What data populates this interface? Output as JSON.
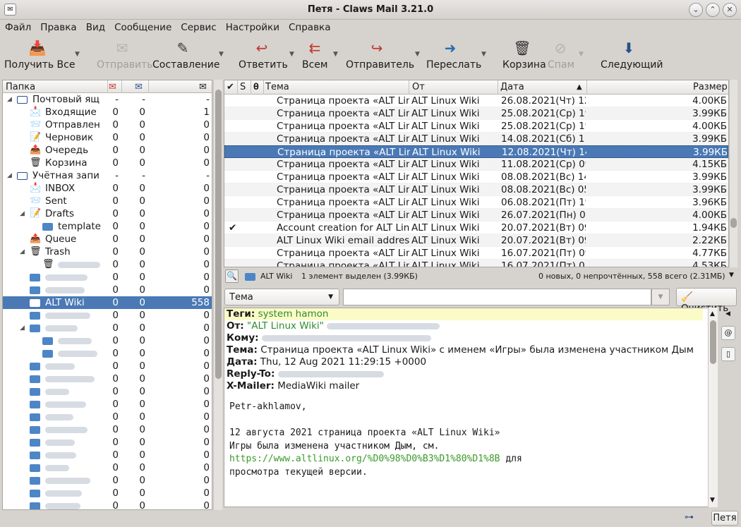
{
  "window": {
    "title": "Петя - Claws Mail 3.21.0"
  },
  "menu": [
    "Файл",
    "Правка",
    "Вид",
    "Сообщение",
    "Сервис",
    "Настройки",
    "Справка"
  ],
  "toolbar": [
    {
      "label": "Получить Все",
      "icon": "get-mail-icon",
      "enabled": true
    },
    {
      "label": "Отправить",
      "icon": "send-icon",
      "enabled": false
    },
    {
      "label": "Составление",
      "icon": "compose-icon",
      "enabled": true
    },
    {
      "label": "Ответить",
      "icon": "reply-icon",
      "enabled": true
    },
    {
      "label": "Всем",
      "icon": "reply-all-icon",
      "enabled": true
    },
    {
      "label": "Отправитель",
      "icon": "reply-sender-icon",
      "enabled": true
    },
    {
      "label": "Переслать",
      "icon": "forward-icon",
      "enabled": true
    },
    {
      "label": "Корзина",
      "icon": "trash-icon",
      "enabled": true
    },
    {
      "label": "Спам",
      "icon": "spam-icon",
      "enabled": false
    },
    {
      "label": "Следующий",
      "icon": "next-icon",
      "enabled": true
    }
  ],
  "folders": {
    "header": "Папка",
    "rows": [
      {
        "name": "Почтовый ящ",
        "new": "-",
        "unread": "-",
        "total": "-",
        "icon": "mailbox-icon"
      },
      {
        "name": "Входящие",
        "new": "0",
        "unread": "0",
        "total": "1",
        "icon": "inbox-icon"
      },
      {
        "name": "Отправлен",
        "new": "0",
        "unread": "0",
        "total": "0",
        "icon": "sent-icon"
      },
      {
        "name": "Черновик",
        "new": "0",
        "unread": "0",
        "total": "0",
        "icon": "drafts-icon"
      },
      {
        "name": "Очередь",
        "new": "0",
        "unread": "0",
        "total": "0",
        "icon": "queue-icon"
      },
      {
        "name": "Корзина",
        "new": "0",
        "unread": "0",
        "total": "0",
        "icon": "trash-icon"
      },
      {
        "name": "Учётная запи",
        "new": "-",
        "unread": "-",
        "total": "-",
        "icon": "mailbox-icon"
      },
      {
        "name": "INBOX",
        "new": "0",
        "unread": "0",
        "total": "0",
        "icon": "inbox-icon"
      },
      {
        "name": "Sent",
        "new": "0",
        "unread": "0",
        "total": "0",
        "icon": "sent-icon"
      },
      {
        "name": "Drafts",
        "new": "0",
        "unread": "0",
        "total": "0",
        "icon": "drafts-icon"
      },
      {
        "name": "template",
        "new": "0",
        "unread": "0",
        "total": "0",
        "icon": "folder-icon"
      },
      {
        "name": "Queue",
        "new": "0",
        "unread": "0",
        "total": "0",
        "icon": "queue-icon"
      },
      {
        "name": "Trash",
        "new": "0",
        "unread": "0",
        "total": "0",
        "icon": "trash-icon"
      },
      {
        "name": "",
        "new": "0",
        "unread": "0",
        "total": "0",
        "icon": "trash-icon"
      },
      {
        "name": "",
        "new": "0",
        "unread": "0",
        "total": "0",
        "icon": "folder-icon"
      },
      {
        "name": "",
        "new": "0",
        "unread": "0",
        "total": "0",
        "icon": "folder-icon"
      },
      {
        "name": "ALT Wiki",
        "new": "0",
        "unread": "0",
        "total": "558",
        "icon": "folder-open-icon"
      },
      {
        "name": "",
        "new": "0",
        "unread": "0",
        "total": "0",
        "icon": "folder-icon"
      },
      {
        "name": "",
        "new": "0",
        "unread": "0",
        "total": "0",
        "icon": "folder-icon"
      },
      {
        "name": "",
        "new": "0",
        "unread": "0",
        "total": "0",
        "icon": "folder-icon"
      },
      {
        "name": "",
        "new": "0",
        "unread": "0",
        "total": "0",
        "icon": "folder-icon"
      },
      {
        "name": "",
        "new": "0",
        "unread": "0",
        "total": "0",
        "icon": "folder-icon"
      },
      {
        "name": "",
        "new": "0",
        "unread": "0",
        "total": "0",
        "icon": "folder-icon"
      },
      {
        "name": "",
        "new": "0",
        "unread": "0",
        "total": "0",
        "icon": "folder-icon"
      },
      {
        "name": "",
        "new": "0",
        "unread": "0",
        "total": "0",
        "icon": "folder-icon"
      },
      {
        "name": "",
        "new": "0",
        "unread": "0",
        "total": "0",
        "icon": "folder-icon"
      },
      {
        "name": "",
        "new": "0",
        "unread": "0",
        "total": "0",
        "icon": "folder-icon"
      },
      {
        "name": "",
        "new": "0",
        "unread": "0",
        "total": "0",
        "icon": "folder-icon"
      },
      {
        "name": "",
        "new": "0",
        "unread": "0",
        "total": "0",
        "icon": "folder-icon"
      },
      {
        "name": "",
        "new": "0",
        "unread": "0",
        "total": "0",
        "icon": "folder-icon"
      },
      {
        "name": "",
        "new": "0",
        "unread": "0",
        "total": "0",
        "icon": "folder-icon"
      },
      {
        "name": "",
        "new": "0",
        "unread": "0",
        "total": "0",
        "icon": "folder-icon"
      },
      {
        "name": "",
        "new": "0",
        "unread": "0",
        "total": "0",
        "icon": "folder-icon"
      }
    ]
  },
  "messages": {
    "headers": {
      "subject": "Тема",
      "from": "От",
      "date": "Дата",
      "size": "Размер",
      "status": "S"
    },
    "rows": [
      {
        "subject": "Страница проекта «ALT Linux Wiki",
        "from": "ALT Linux Wiki",
        "date": "26.08.2021(Чт) 12::",
        "size": "4.00КБ",
        "check": ""
      },
      {
        "subject": "Страница проекта «ALT Linux Wiki",
        "from": "ALT Linux Wiki",
        "date": "25.08.2021(Ср) 19:",
        "size": "3.99КБ",
        "check": ""
      },
      {
        "subject": "Страница проекта «ALT Linux Wiki",
        "from": "ALT Linux Wiki",
        "date": "25.08.2021(Ср) 19:",
        "size": "4.00КБ",
        "check": ""
      },
      {
        "subject": "Страница проекта «ALT Linux Wiki",
        "from": "ALT Linux Wiki",
        "date": "14.08.2021(Сб) 11:",
        "size": "3.99КБ",
        "check": ""
      },
      {
        "subject": "Страница проекта «ALT Linux Wiki",
        "from": "ALT Linux Wiki",
        "date": "12.08.2021(Чт) 14::",
        "size": "3.99КБ",
        "check": ""
      },
      {
        "subject": "Страница проекта «ALT Linux Wiki",
        "from": "ALT Linux Wiki",
        "date": "11.08.2021(Ср) 09:",
        "size": "4.15КБ",
        "check": ""
      },
      {
        "subject": "Страница проекта «ALT Linux Wiki",
        "from": "ALT Linux Wiki",
        "date": "08.08.2021(Вс) 14::",
        "size": "3.99КБ",
        "check": ""
      },
      {
        "subject": "Страница проекта «ALT Linux Wiki",
        "from": "ALT Linux Wiki",
        "date": "08.08.2021(Вс) 05::",
        "size": "3.99КБ",
        "check": ""
      },
      {
        "subject": "Страница проекта «ALT Linux Wiki",
        "from": "ALT Linux Wiki",
        "date": "06.08.2021(Пт) 19:",
        "size": "3.96КБ",
        "check": ""
      },
      {
        "subject": "Страница проекта «ALT Linux Wiki",
        "from": "ALT Linux Wiki",
        "date": "26.07.2021(Пн) 06:",
        "size": "4.00КБ",
        "check": ""
      },
      {
        "subject": "Account creation for ALT Linux",
        "from": "ALT Linux Wiki",
        "date": "20.07.2021(Вт) 09::",
        "size": "1.94КБ",
        "check": "✔"
      },
      {
        "subject": "ALT Linux Wiki email address c",
        "from": "ALT Linux Wiki",
        "date": "20.07.2021(Вт) 09:",
        "size": "2.22КБ",
        "check": ""
      },
      {
        "subject": "Страница проекта «ALT Linux Wiki",
        "from": "ALT Linux Wiki",
        "date": "16.07.2021(Пт) 09:",
        "size": "4.77КБ",
        "check": ""
      },
      {
        "subject": "Страница проекта «ALT Linux Wiki",
        "from": "ALT Linux Wiki",
        "date": "16.07.2021(Пт) 03:",
        "size": "4.53КБ",
        "check": ""
      }
    ]
  },
  "status": {
    "folder": "ALT Wiki",
    "selection": "1 элемент выделен (3.99КБ)",
    "counts": "0 новых, 0 непрочтённых, 558 всего (2.31МБ)"
  },
  "filter": {
    "field": "Тема",
    "clear_label": "Очистить"
  },
  "message": {
    "tags_label": "Теги:",
    "tags_value": "system hamon",
    "from_label": "От:",
    "from_value": "\"ALT Linux Wiki\"",
    "to_label": "Кому:",
    "subject_label": "Тема:",
    "subject_value": "Страница проекта «ALT Linux Wiki» с именем «Игры» была изменена участником Дым",
    "date_label": "Дата:",
    "date_value": "Thu, 12 Aug 2021 11:29:15 +0000",
    "replyto_label": "Reply-To:",
    "mailer_label": "X-Mailer:",
    "mailer_value": "MediaWiki mailer",
    "greeting": "Petr-akhlamov,",
    "line1": "12 августа 2021 страница проекта «ALT Linux Wiki»",
    "line2": "Игры была изменена участником Дым, см.",
    "link": "https://www.altlinux.org/%D0%98%D0%B3%D1%80%D1%8B",
    "link_suffix": " для",
    "line4": "просмотра текущей версии."
  },
  "bottom": {
    "account_button": "Петя"
  }
}
